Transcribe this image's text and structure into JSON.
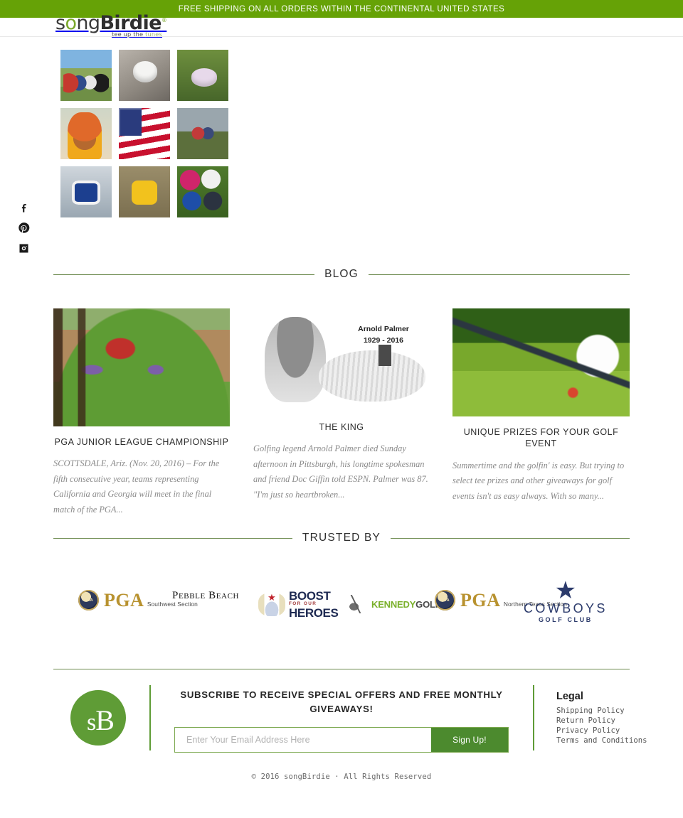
{
  "announcement": {
    "text": "FREE SHIPPING ON ALL ORDERS WITHIN THE CONTINENTAL UNITED STATES",
    "bg_color": "#66a206"
  },
  "brand": {
    "name_part1": "s",
    "name_o": "o",
    "name_part2": "ng",
    "name_bold": "Birdie",
    "trademark": "®",
    "tagline_1": "tee up the ",
    "tagline_2": "tunes"
  },
  "social": {
    "items": [
      {
        "name": "facebook",
        "label": "Facebook"
      },
      {
        "name": "pinterest",
        "label": "Pinterest"
      },
      {
        "name": "instagram",
        "label": "Instagram"
      }
    ]
  },
  "instagram_grid": {
    "cells": [
      {
        "alt": "Four golfers posing on the course",
        "style": "ph-group"
      },
      {
        "alt": "White songBirdie speaker with lanyard on rock",
        "style": "ph-speaker-w"
      },
      {
        "alt": "Lavender songBirdie speaker in the grass",
        "style": "ph-speaker-p"
      },
      {
        "alt": "Smiling boy wearing an orange turban",
        "style": "ph-boy"
      },
      {
        "alt": "American flag waving",
        "style": "ph-flag"
      },
      {
        "alt": "Two junior golfers with a golf bag at dusk",
        "style": "ph-kids"
      },
      {
        "alt": "Blue songBirdie speaker close-up",
        "style": "ph-speaker-b"
      },
      {
        "alt": "Yellow songBirdie speaker hanging on a fence",
        "style": "ph-speaker-y"
      },
      {
        "alt": "Pile of colorful songBirdie speakers in the grass",
        "style": "ph-speakers"
      }
    ]
  },
  "blog": {
    "heading": "BLOG",
    "posts": [
      {
        "title": "PGA JUNIOR LEAGUE CHAMPIONSHIP",
        "excerpt": "SCOTTSDALE, Ariz. (Nov. 20, 2016) –  For the fifth consecutive year, teams representing California and Georgia will meet in the final match of the PGA...",
        "image_alt": "Junior golfers playing out of a bunker at a desert course"
      },
      {
        "title": "THE KING",
        "excerpt": "Golfing legend Arnold Palmer died Sunday afternoon in Pittsburgh, his longtime spokesman and friend Doc Giffin told ESPN. Palmer was 87. \"I'm just so heartbroken...",
        "image_alt": "Illustrated tribute portrait of Arnold Palmer",
        "image_caption_line1": "Arnold Palmer",
        "image_caption_line2": "1929 - 2016"
      },
      {
        "title": "UNIQUE PRIZES FOR YOUR GOLF EVENT",
        "excerpt": "Summertime and the golfin' is easy. But trying to select tee prizes and other giveaways for golf events isn't as easy always. With so many...",
        "image_alt": "Golf club addressing a ball on a red tee"
      }
    ]
  },
  "trusted_by": {
    "heading": "TRUSTED BY",
    "logos": [
      {
        "name": "pga-southwest-section",
        "main": "PGA",
        "sub": "Southwest Section",
        "seal": "PGA"
      },
      {
        "name": "pebble-beach",
        "main": "Pebble Beach"
      },
      {
        "name": "boost-for-our-heroes",
        "line1": "BOOST",
        "line2": "FOR OUR",
        "line3": "HEROES"
      },
      {
        "name": "kennedy-golf",
        "part1": "KENNEDY",
        "part2": "GOLF"
      },
      {
        "name": "pga-northern-texas-section",
        "main": "PGA",
        "sub": "Northern Texas Section",
        "seal": "PGA"
      },
      {
        "name": "cowboys-golf-club",
        "line1": "COWBOYS",
        "line2": "GOLF CLUB"
      }
    ]
  },
  "footer": {
    "badge_text_s": "s",
    "badge_text_b": "B",
    "subscribe": {
      "heading": "SUBSCRIBE TO RECEIVE SPECIAL OFFERS AND FREE MONTHLY GIVEAWAYS!",
      "placeholder": "Enter Your Email Address Here",
      "value": "",
      "button": "Sign Up!"
    },
    "legal": {
      "heading": "Legal",
      "links": [
        "Shipping Policy",
        "Return Policy",
        "Privacy Policy",
        "Terms and Conditions"
      ]
    },
    "copyright": "© 2016 songBirdie · All Rights Reserved"
  },
  "colors": {
    "green_bar": "#66a206",
    "green_rule": "#6c8a4e",
    "green_badge": "#5f9c36",
    "green_button": "#4c8a2e"
  }
}
